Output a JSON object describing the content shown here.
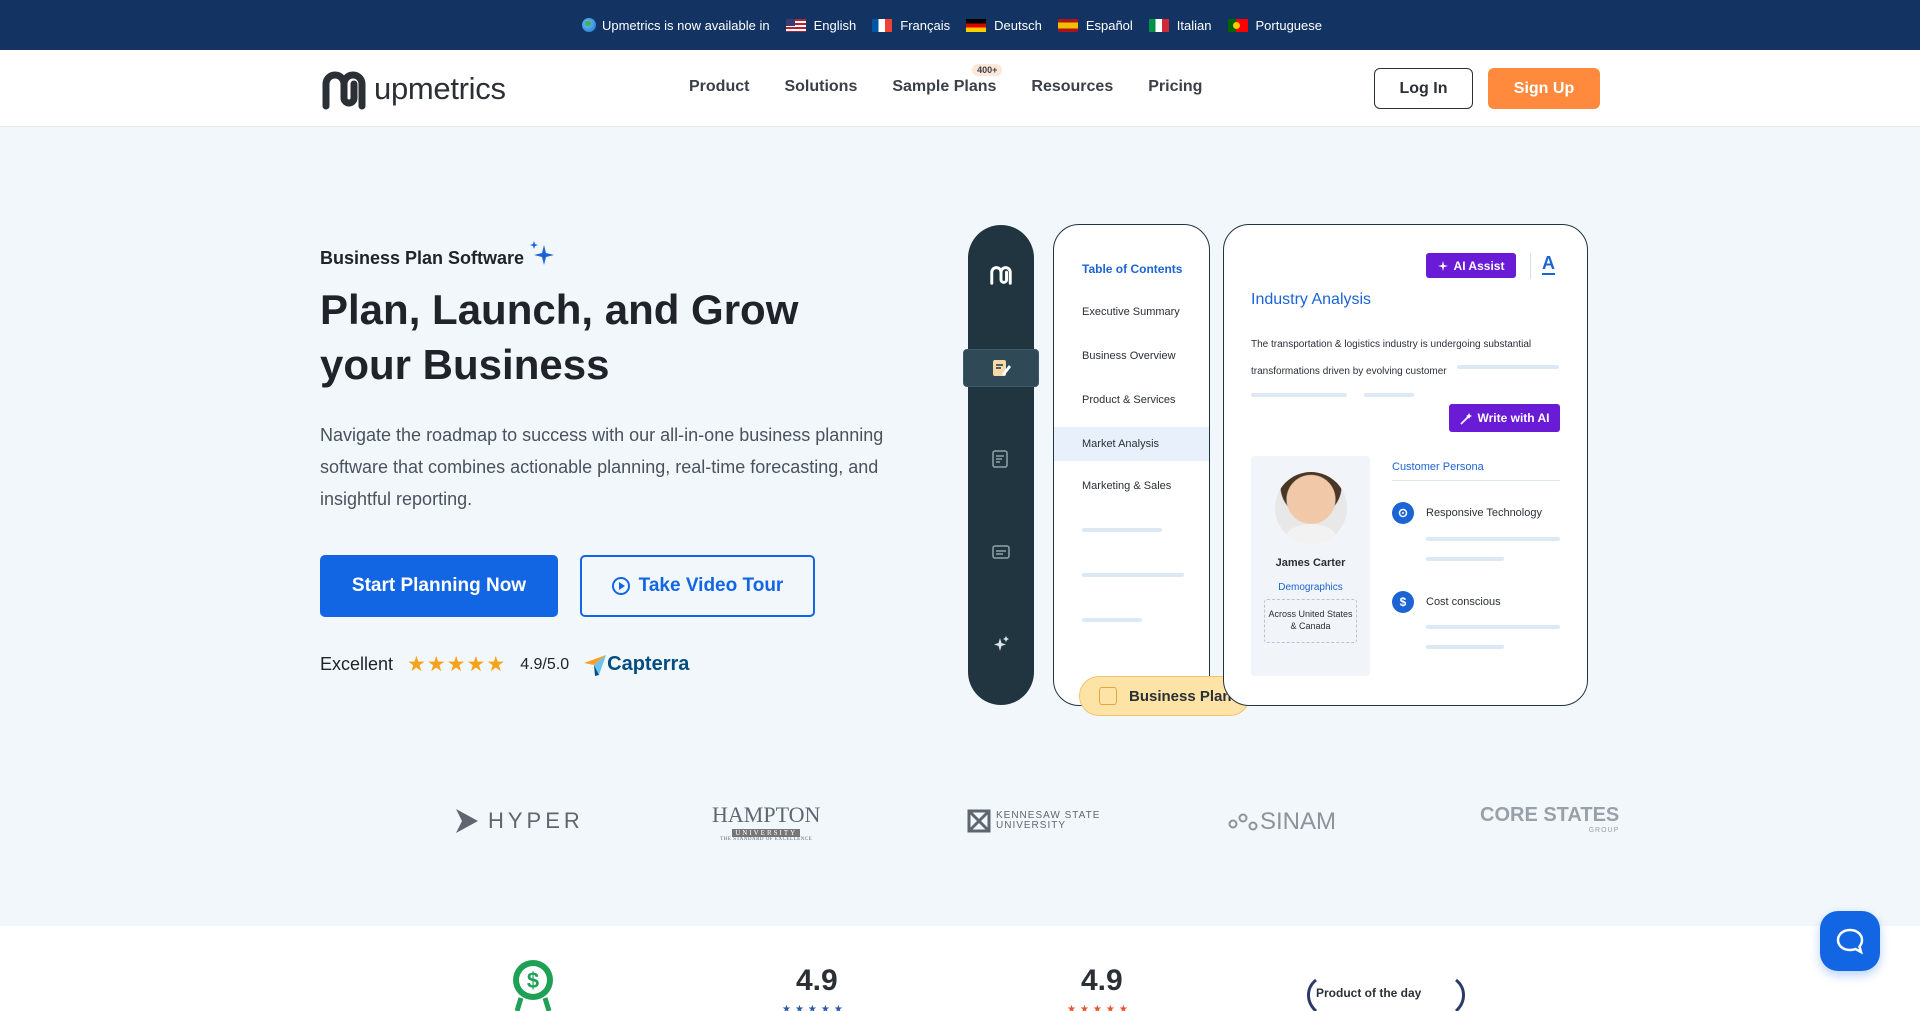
{
  "topbar": {
    "intro": "Upmetrics is now available in",
    "languages": [
      {
        "label": "English",
        "flag": "flag-en"
      },
      {
        "label": "Français",
        "flag": "flag-fr"
      },
      {
        "label": "Deutsch",
        "flag": "flag-de"
      },
      {
        "label": "Español",
        "flag": "flag-es"
      },
      {
        "label": "Italian",
        "flag": "flag-it"
      },
      {
        "label": "Portuguese",
        "flag": "flag-pt"
      }
    ]
  },
  "header": {
    "logo_text": "upmetrics",
    "nav": [
      "Product",
      "Solutions",
      "Sample Plans",
      "Resources",
      "Pricing"
    ],
    "nav_badge": "400+",
    "login_label": "Log In",
    "signup_label": "Sign Up"
  },
  "hero": {
    "eyebrow": "Business Plan Software",
    "title": "Plan, Launch, and Grow your Business",
    "description": "Navigate the roadmap to success with our all-in-one business planning software that combines actionable planning, real-time forecasting, and insightful reporting.",
    "primary_cta": "Start Planning Now",
    "secondary_cta": "Take Video Tour",
    "rating_label": "Excellent",
    "stars": "★★★★★",
    "rating_score": "4.9/5.0",
    "rating_source": "Capterra"
  },
  "mockup": {
    "toc_title": "Table of Contents",
    "toc_items": [
      "Executive Summary",
      "Business Overview",
      "Product & Services",
      "Market Analysis",
      "Marketing & Sales"
    ],
    "badge_label": "Business Plan",
    "ai_assist": "AI Assist",
    "font_glyph": "A",
    "section_title": "Industry  Analysis",
    "section_text_1": "The transportation & logistics industry is undergoing substantial",
    "section_text_2": "transformations driven by evolving customer",
    "write_ai": "Write with AI",
    "persona_name": "James Carter",
    "demographics_label": "Demographics",
    "demographics_value": "Across United States & Canada",
    "persona_title": "Customer Persona",
    "traits": [
      "Responsive Technology",
      "Cost conscious"
    ]
  },
  "clients": {
    "hyper": "HYPER",
    "hampton": "HAMPTON",
    "hampton_sub": "UNIVERSITY",
    "hampton_tagline": "THE STANDARD OF EXCELLENCE",
    "kennesaw_1": "KENNESAW STATE",
    "kennesaw_2": "UNIVERSITY",
    "sinam": "SINAM",
    "corestates": "CORE STATES",
    "corestates_sub": "GROUP"
  },
  "stats": {
    "score_1": "4.9",
    "score_2": "4.9",
    "product_of_day": "Product of the day"
  },
  "colors": {
    "primary": "#1366e3",
    "accent": "#ff8a3d",
    "ai_purple": "#6a1bd6",
    "topbar": "#133463",
    "sidebar": "#20353f"
  }
}
